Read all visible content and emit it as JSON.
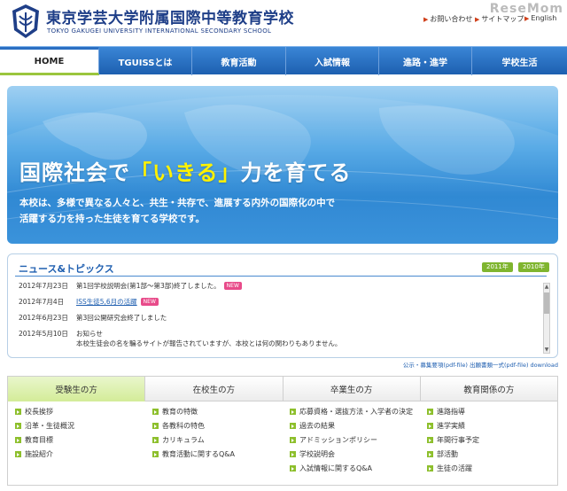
{
  "header": {
    "title_ja": "東京学芸大学附属国際中等教育学校",
    "title_en": "TOKYO GAKUGEI UNIVERSITY INTERNATIONAL SECONDARY SCHOOL",
    "util_links": [
      "お問い合わせ",
      "サイトマップ",
      "English"
    ],
    "watermark": "ReseMom"
  },
  "nav": {
    "items": [
      "HOME",
      "TGUISSとは",
      "教育活動",
      "入試情報",
      "進路・進学",
      "学校生活"
    ]
  },
  "hero": {
    "slogan_pre": "国際社会で",
    "slogan_hl": "「いきる」",
    "slogan_post": "力を育てる",
    "desc": "本校は、多様で異なる人々と、共生・共存で、進展する内外の国際化の中で活躍する力を持った生徒を育てる学校です。"
  },
  "news": {
    "title": "ニュース&トピックス",
    "year_tabs": [
      "2011年",
      "2010年"
    ],
    "new_badge": "NEW",
    "rows": [
      {
        "date": "2012年7月23日",
        "text": "第1回学校説明会(第1部〜第3部)終了しました。"
      },
      {
        "date": "2012年7月4日",
        "text": "ISS生徒5,6月の活躍"
      },
      {
        "date": "2012年6月23日",
        "text": "第3回公開研究会終了しました"
      },
      {
        "date": "2012年5月10日",
        "text": "お知らせ",
        "text2": "本校生徒会の名を騙るサイトが報告されていますが、本校とは何の関わりもありません。"
      }
    ],
    "footer": "公示・募集要項(pdf-file) 出願書類一式(pdf-file) download"
  },
  "audience": {
    "tabs": [
      "受験生の方",
      "在校生の方",
      "卒業生の方",
      "教育関係の方"
    ],
    "columns": [
      [
        "校長挨拶",
        "沿革・生徒概況",
        "教育目標",
        "施設紹介"
      ],
      [
        "教育の特徴",
        "各教科の特色",
        "カリキュラム",
        "教育活動に関するQ&A"
      ],
      [
        "応募資格・選抜方法・入学者の決定",
        "過去の結果",
        "アドミッションポリシー",
        "学校説明会",
        "入試情報に関するQ&A"
      ],
      [
        "進路指導",
        "進学実績",
        "年間行事予定",
        "部活動",
        "生徒の活躍"
      ]
    ]
  },
  "colors": {
    "brand_blue": "#1f3f88",
    "nav_blue": "#2b6fc2",
    "accent_green": "#8dbf2c",
    "slogan_yellow": "#fff200"
  }
}
